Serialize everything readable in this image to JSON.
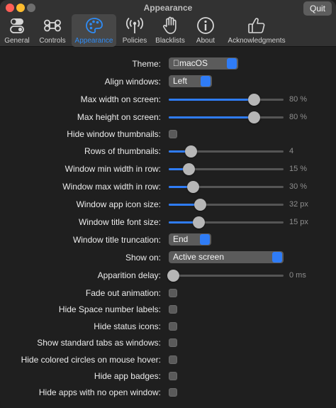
{
  "window": {
    "title": "Appearance",
    "quit_label": "Quit"
  },
  "tabs": [
    {
      "label": "General",
      "icon": "toggles-icon"
    },
    {
      "label": "Controls",
      "icon": "command-key-icon"
    },
    {
      "label": "Appearance",
      "icon": "palette-icon",
      "active": true
    },
    {
      "label": "Policies",
      "icon": "broadcast-icon"
    },
    {
      "label": "Blacklists",
      "icon": "hand-icon"
    },
    {
      "label": "About",
      "icon": "info-icon"
    },
    {
      "label": "Acknowledgments",
      "icon": "thumbs-up-icon"
    }
  ],
  "settings": {
    "theme": {
      "label": "Theme:",
      "value": "macOS"
    },
    "align_windows": {
      "label": "Align windows:",
      "value": "Left"
    },
    "max_width": {
      "label": "Max width on screen:",
      "value": 80,
      "unit": "%",
      "display": "80 %"
    },
    "max_height": {
      "label": "Max height on screen:",
      "value": 80,
      "unit": "%",
      "display": "80 %"
    },
    "hide_thumbnails": {
      "label": "Hide window thumbnails:",
      "checked": false
    },
    "rows_of_thumbnails": {
      "label": "Rows of thumbnails:",
      "value": 4,
      "display": "4",
      "fraction": 0.19
    },
    "window_min_width": {
      "label": "Window min width in row:",
      "value": 15,
      "display": "15 %",
      "fraction": 0.17
    },
    "window_max_width": {
      "label": "Window max width in row:",
      "value": 30,
      "display": "30 %",
      "fraction": 0.21
    },
    "app_icon_size": {
      "label": "Window app icon size:",
      "value": 32,
      "display": "32 px",
      "fraction": 0.27
    },
    "title_font_size": {
      "label": "Window title font size:",
      "value": 15,
      "display": "15 px",
      "fraction": 0.26
    },
    "title_truncation": {
      "label": "Window title truncation:",
      "value": "End"
    },
    "show_on": {
      "label": "Show on:",
      "value": "Active screen"
    },
    "apparition_delay": {
      "label": "Apparition delay:",
      "value": 0,
      "display": "0 ms",
      "fraction": 0.0
    },
    "fade_out": {
      "label": "Fade out animation:",
      "checked": false
    },
    "hide_space_labels": {
      "label": "Hide Space number labels:",
      "checked": false
    },
    "hide_status_icons": {
      "label": "Hide status icons:",
      "checked": false
    },
    "show_standard_tabs": {
      "label": "Show standard tabs as windows:",
      "checked": false
    },
    "hide_colored_circles": {
      "label": "Hide colored circles on mouse hover:",
      "checked": false
    },
    "hide_app_badges": {
      "label": "Hide app badges:",
      "checked": false
    },
    "hide_apps_no_window": {
      "label": "Hide apps with no open window:",
      "checked": false
    }
  },
  "colors": {
    "accent": "#2f7cf6",
    "background": "#1f1f1f",
    "titlebar": "#323232"
  }
}
